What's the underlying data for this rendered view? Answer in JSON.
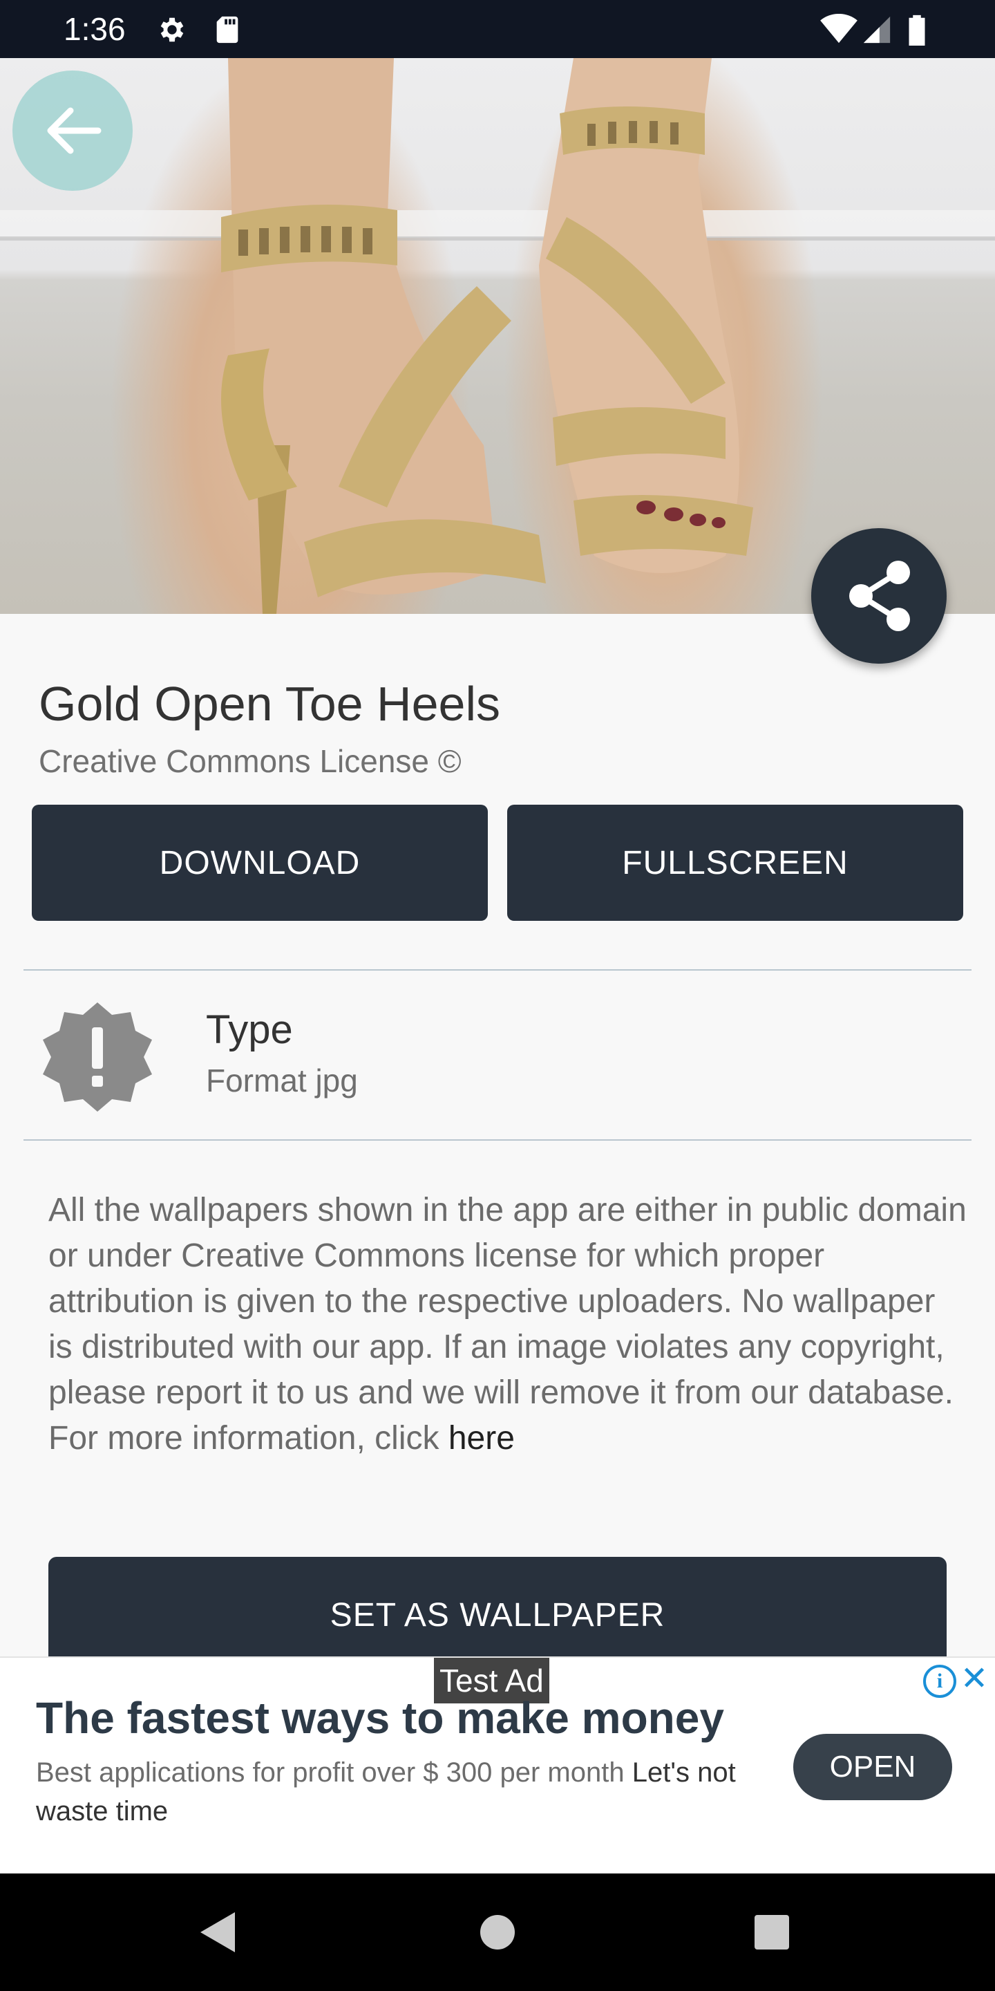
{
  "status_bar": {
    "time": "1:36",
    "icons": [
      "gear-icon",
      "sd-card-icon",
      "wifi-icon",
      "signal-icon",
      "battery-icon"
    ],
    "background": "#101623"
  },
  "header": {
    "back_icon": "arrow-left-icon",
    "share_icon": "share-icon"
  },
  "wallpaper": {
    "title": "Gold Open Toe Heels",
    "license": "Creative Commons License ©",
    "buttons": {
      "download": "DOWNLOAD",
      "fullscreen": "FULLSCREEN"
    },
    "info": {
      "label": "Type",
      "value": "Format jpg",
      "icon": "alert-badge-icon"
    },
    "disclaimer": "All the wallpapers shown in the app are either in public domain or under Creative Commons license for which proper attribution is given to the respective uploaders. No wallpaper is distributed with our app. If an image violates any copyright, please report it to us and we will remove it from our database. For more information, click ",
    "disclaimer_link": "here",
    "set_wallpaper": "SET AS WALLPAPER"
  },
  "ad": {
    "tag": "Test Ad",
    "headline": "The fastest ways to make money",
    "body": "Best applications for profit over $ 300 per month",
    "body_cta": "Let's not waste time",
    "open_label": "OPEN",
    "info_icon": "info-icon",
    "close_icon": "close-icon"
  },
  "nav_bar": {
    "icons": [
      "back-triangle-icon",
      "home-circle-icon",
      "recents-square-icon"
    ]
  },
  "colors": {
    "primary_dark": "#28313d",
    "accent_teal": "#98d0ce",
    "ad_blue": "#1a8fd7"
  }
}
